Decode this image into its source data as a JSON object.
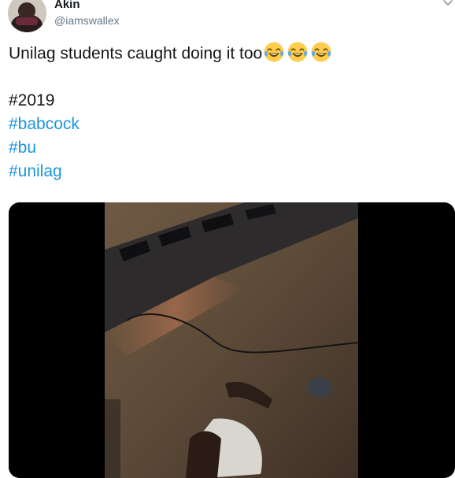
{
  "tweet": {
    "author_name": "Akin",
    "author_handle": "@iamswallex",
    "text_main": "Unilag students caught doing it too",
    "emojis": [
      "face-with-tears-of-joy",
      "face-with-tears-of-joy",
      "face-with-tears-of-joy"
    ],
    "plain_tag": "#2019",
    "hashtags": [
      "#babcock",
      "#bu",
      "#unilag"
    ]
  },
  "colors": {
    "hashtag": "#1b95e0",
    "text": "#14171a",
    "handle": "#657786",
    "media_background": "#000000"
  },
  "icons": {
    "caret": "chevron-down-icon",
    "avatar": "user-avatar",
    "emoji": "face-with-tears-of-joy"
  }
}
